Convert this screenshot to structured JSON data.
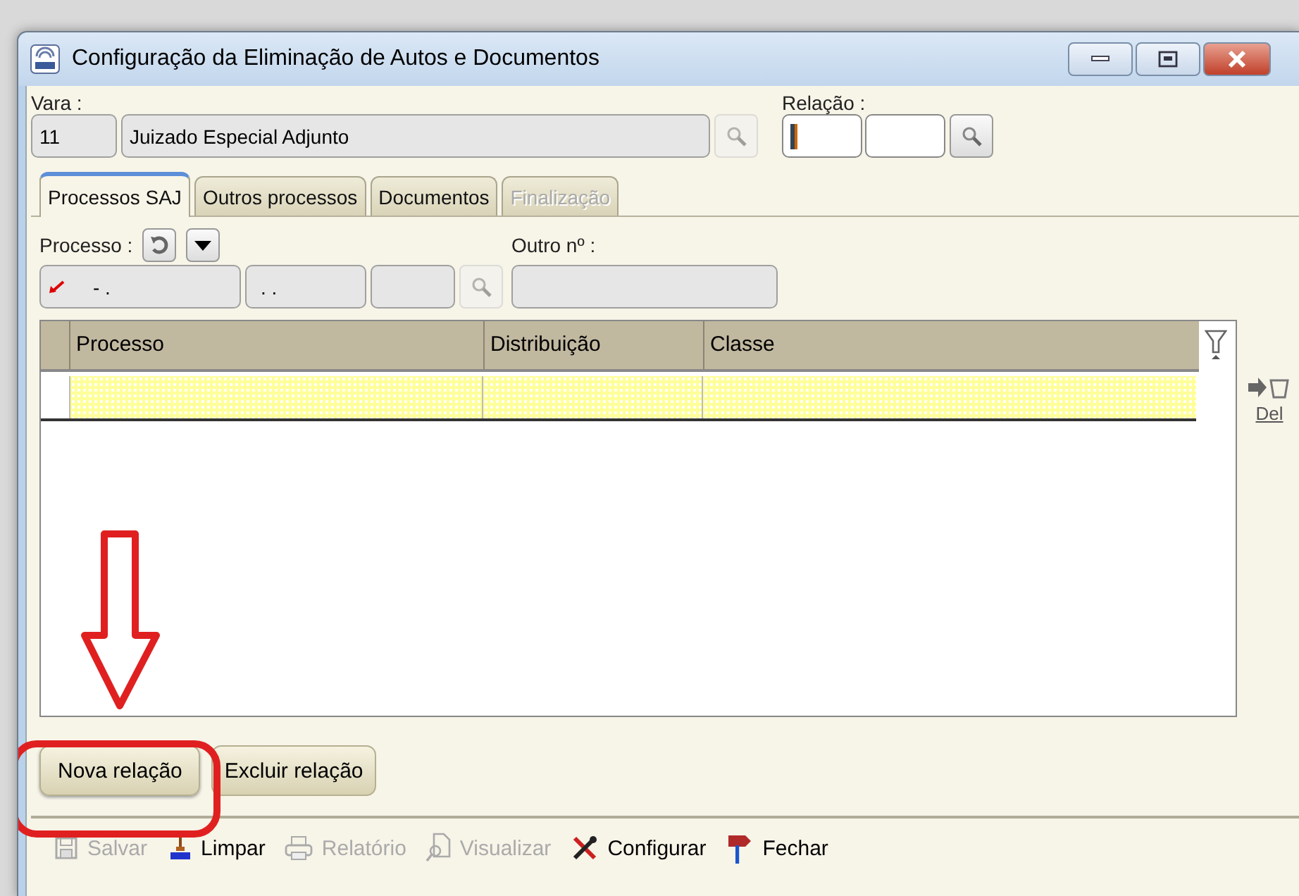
{
  "window": {
    "title": "Configuração da Eliminação de Autos e Documentos",
    "controls": [
      {
        "kind": "minimize"
      },
      {
        "kind": "maximize"
      },
      {
        "kind": "close"
      }
    ]
  },
  "vara": {
    "label": "Vara :",
    "code": "11",
    "name": "Juizado Especial Adjunto"
  },
  "relacao": {
    "label": "Relação :"
  },
  "tabs": [
    {
      "label": "Processos SAJ",
      "selected": true,
      "disabled": false
    },
    {
      "label": "Outros processos",
      "selected": false,
      "disabled": false
    },
    {
      "label": "Documentos",
      "selected": false,
      "disabled": false
    },
    {
      "label": "Finalização",
      "selected": false,
      "disabled": true
    }
  ],
  "processo": {
    "label": "Processo :",
    "part_1": "- .",
    "part_2": ". .",
    "outro_label": "Outro nº :"
  },
  "table": {
    "columns": [
      "Processo",
      "Distribuição",
      "Classe"
    ],
    "delete_label": "Del"
  },
  "buttons": [
    "Nova relação",
    "Excluir relação"
  ],
  "toolbar": [
    {
      "kind": "save",
      "label": "Salvar",
      "disabled": true
    },
    {
      "kind": "clear",
      "label": "Limpar",
      "disabled": false
    },
    {
      "kind": "print",
      "label": "Relatório",
      "disabled": true
    },
    {
      "kind": "preview",
      "label": "Visualizar",
      "disabled": true
    },
    {
      "kind": "tools",
      "label": "Configurar",
      "disabled": false
    },
    {
      "kind": "exit",
      "label": "Fechar",
      "disabled": false
    }
  ]
}
